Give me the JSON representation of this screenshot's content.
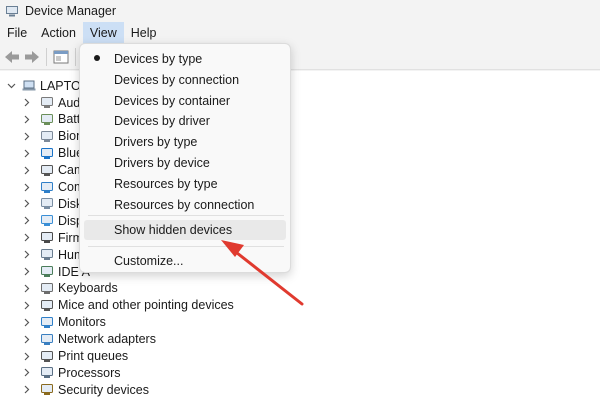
{
  "window": {
    "title": "Device Manager"
  },
  "menubar": {
    "items": [
      "File",
      "Action",
      "View",
      "Help"
    ],
    "active": "View"
  },
  "tree": {
    "root_label": "LAPTOP-",
    "categories": [
      {
        "label": "Aud",
        "icon": "speaker-icon"
      },
      {
        "label": "Batt",
        "icon": "battery-icon"
      },
      {
        "label": "Bion",
        "icon": "biometric-icon"
      },
      {
        "label": "Blue",
        "icon": "bluetooth-icon"
      },
      {
        "label": "Cam",
        "icon": "camera-icon"
      },
      {
        "label": "Com",
        "icon": "computer-icon"
      },
      {
        "label": "Disk",
        "icon": "disk-icon"
      },
      {
        "label": "Disp",
        "icon": "display-icon"
      },
      {
        "label": "Firm",
        "icon": "firmware-icon"
      },
      {
        "label": "Hum",
        "icon": "hid-icon"
      },
      {
        "label": "IDE A",
        "icon": "ide-icon"
      },
      {
        "label": "Keyboards",
        "icon": "keyboard-icon"
      },
      {
        "label": "Mice and other pointing devices",
        "icon": "mouse-icon"
      },
      {
        "label": "Monitors",
        "icon": "monitor-icon"
      },
      {
        "label": "Network adapters",
        "icon": "network-icon"
      },
      {
        "label": "Print queues",
        "icon": "printer-icon"
      },
      {
        "label": "Processors",
        "icon": "processor-icon"
      },
      {
        "label": "Security devices",
        "icon": "security-icon"
      }
    ]
  },
  "view_menu": {
    "items": [
      {
        "label": "Devices by type",
        "checked": true
      },
      {
        "label": "Devices by connection",
        "checked": false
      },
      {
        "label": "Devices by container",
        "checked": false
      },
      {
        "label": "Devices by driver",
        "checked": false
      },
      {
        "label": "Drivers by type",
        "checked": false
      },
      {
        "label": "Drivers by device",
        "checked": false
      },
      {
        "label": "Resources by type",
        "checked": false
      },
      {
        "label": "Resources by connection",
        "checked": false
      }
    ],
    "show_hidden": "Show hidden devices",
    "customize": "Customize..."
  },
  "colors": {
    "arrow": "#e03a2f",
    "menu_active": "#ccdff5",
    "accent": "#0067c0"
  }
}
